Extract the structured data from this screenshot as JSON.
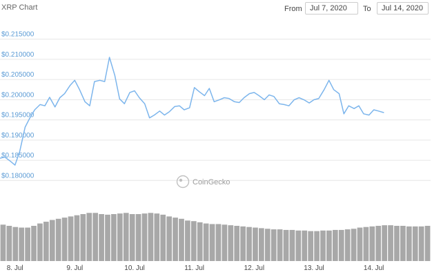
{
  "header": {
    "title": "XRP Chart",
    "from_label": "From",
    "from_value": "Jul 7, 2020",
    "to_label": "To",
    "to_value": "Jul 14, 2020"
  },
  "watermark": "CoinGecko",
  "colors": {
    "line": "#7cb5ec",
    "volume": "#a8a8a8",
    "grid": "#e6e6e6",
    "ytick": "#5b9bd5"
  },
  "chart_data": {
    "type": "line",
    "title": "XRP Chart",
    "xlabel": "",
    "ylabel": "",
    "ylim": [
      0.178,
      0.217
    ],
    "x_range": [
      7.75,
      14.95
    ],
    "grid": true,
    "yticks": [
      0.18,
      0.185,
      0.19,
      0.195,
      0.2,
      0.205,
      0.21,
      0.215
    ],
    "ytick_labels": [
      "$0.180000",
      "$0.185000",
      "$0.190000",
      "$0.195000",
      "$0.200000",
      "$0.205000",
      "$0.210000",
      "$0.215000"
    ],
    "xticks": [
      8,
      9,
      10,
      11,
      12,
      13,
      14
    ],
    "xtick_labels": [
      "8. Jul",
      "9. Jul",
      "10. Jul",
      "11. Jul",
      "12. Jul",
      "13. Jul",
      "14. Jul"
    ],
    "x": [
      7.75,
      7.83,
      7.92,
      8.0,
      8.08,
      8.17,
      8.25,
      8.33,
      8.42,
      8.5,
      8.58,
      8.67,
      8.75,
      8.83,
      8.92,
      9.0,
      9.08,
      9.17,
      9.25,
      9.33,
      9.42,
      9.5,
      9.58,
      9.67,
      9.75,
      9.83,
      9.92,
      10.0,
      10.08,
      10.17,
      10.25,
      10.33,
      10.42,
      10.5,
      10.58,
      10.67,
      10.75,
      10.83,
      10.92,
      11.0,
      11.08,
      11.17,
      11.25,
      11.33,
      11.42,
      11.5,
      11.58,
      11.67,
      11.75,
      11.83,
      11.92,
      12.0,
      12.08,
      12.17,
      12.25,
      12.33,
      12.42,
      12.5,
      12.58,
      12.67,
      12.75,
      12.83,
      12.92,
      13.0,
      13.08,
      13.17,
      13.25,
      13.33,
      13.42,
      13.5,
      13.58,
      13.67,
      13.75,
      13.83,
      13.92,
      14.0,
      14.08,
      14.17,
      14.25,
      14.33,
      14.42,
      14.5,
      14.58,
      14.67,
      14.75,
      14.83,
      14.95
    ],
    "series": [
      {
        "values": [
          0.1855,
          0.1858,
          0.1848,
          0.1838,
          0.1872,
          0.1932,
          0.1955,
          0.1975,
          0.1988,
          0.1985,
          0.2006,
          0.1982,
          0.2005,
          0.2015,
          0.2035,
          0.2048,
          0.2025,
          0.1995,
          0.1985,
          0.2045,
          0.2048,
          0.2045,
          0.2105,
          0.206,
          0.2002,
          0.199,
          0.2018,
          0.2022,
          0.2005,
          0.199,
          0.1955,
          0.1962,
          0.1972,
          0.1962,
          0.197,
          0.1983,
          0.1985,
          0.1975,
          0.198,
          0.203,
          0.202,
          0.201,
          0.2028,
          0.1995,
          0.2,
          0.2005,
          0.2003,
          0.1995,
          0.1993,
          0.2005,
          0.2015,
          0.2018,
          0.201,
          0.2,
          0.2012,
          0.2008,
          0.199,
          0.1988,
          0.1985,
          0.2,
          0.2005,
          0.2,
          0.1992,
          0.2,
          0.2003,
          0.2025,
          0.2048,
          0.2025,
          0.2015,
          0.1965,
          0.1985,
          0.1978,
          0.1985,
          0.1965,
          0.1962,
          0.1975,
          0.1972,
          0.1968
        ]
      }
    ],
    "volume": [
      0.62,
      0.6,
      0.58,
      0.57,
      0.57,
      0.6,
      0.64,
      0.67,
      0.7,
      0.72,
      0.74,
      0.76,
      0.78,
      0.8,
      0.82,
      0.82,
      0.8,
      0.79,
      0.8,
      0.81,
      0.82,
      0.8,
      0.8,
      0.81,
      0.82,
      0.81,
      0.79,
      0.76,
      0.74,
      0.72,
      0.69,
      0.68,
      0.66,
      0.64,
      0.63,
      0.63,
      0.62,
      0.61,
      0.6,
      0.59,
      0.58,
      0.57,
      0.56,
      0.55,
      0.54,
      0.54,
      0.53,
      0.53,
      0.52,
      0.52,
      0.51,
      0.51,
      0.52,
      0.52,
      0.53,
      0.53,
      0.54,
      0.55,
      0.57,
      0.58,
      0.59,
      0.6,
      0.61,
      0.61,
      0.6,
      0.6,
      0.59,
      0.59,
      0.59,
      0.6
    ]
  }
}
